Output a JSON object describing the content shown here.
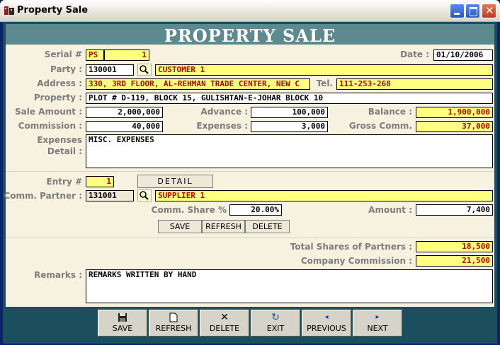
{
  "window": {
    "title": "Property Sale"
  },
  "header": {
    "title": "PROPERTY SALE"
  },
  "labels": {
    "serial": "Serial #",
    "date": "Date :",
    "party": "Party :",
    "address": "Address :",
    "tel": "Tel.",
    "property": "Property :",
    "sale_amount": "Sale Amount :",
    "advance": "Advance :",
    "balance": "Balance :",
    "commission": "Commission :",
    "expenses": "Expenses :",
    "gross_comm": "Gross Comm.",
    "expenses_detail_1": "Expenses",
    "expenses_detail_2": "Detail :",
    "entry": "Entry #",
    "comm_partner": "Comm. Partner :",
    "comm_share": "Comm. Share %",
    "amount": "Amount :",
    "total_shares": "Total Shares of Partners :",
    "company_commission": "Company Commission :",
    "remarks": "Remarks :"
  },
  "fields": {
    "serial_prefix": "PS",
    "serial_no": "1",
    "date": "01/10/2006",
    "party_code": "130001",
    "party_name": "CUSTOMER 1",
    "address": "330, 3RD FLOOR, AL-REHMAN TRADE CENTER, NEW C",
    "tel": "111-253-268",
    "property": "PLOT # D-119, BLOCK 15, GULISHTAN-E-JOHAR BLOCK 10",
    "sale_amount": "2,000,000",
    "advance": "100,000",
    "balance": "1,900,000",
    "commission": "40,000",
    "expenses": "3,000",
    "gross_comm": "37,000",
    "expenses_detail": "MISC. EXPENSES",
    "entry": "1",
    "partner_code": "131001",
    "partner_name": "SUPPLIER 1",
    "comm_share": "20.00%",
    "amount": "7,400",
    "total_shares": "18,500",
    "company_commission": "21,500",
    "remarks": "REMARKS WRITTEN BY HAND"
  },
  "buttons": {
    "detail": "DETAIL",
    "partner_save": "SAVE",
    "partner_refresh": "REFRESH",
    "partner_delete": "DELETE"
  },
  "toolbar": [
    {
      "name": "save",
      "label": "SAVE",
      "icon": "floppy-icon"
    },
    {
      "name": "refresh",
      "label": "REFRESH",
      "icon": "page-icon"
    },
    {
      "name": "delete",
      "label": "DELETE",
      "icon": "x-icon"
    },
    {
      "name": "exit",
      "label": "EXIT",
      "icon": "exit-icon"
    },
    {
      "name": "previous",
      "label": "PREVIOUS",
      "icon": "left-arrow-icon"
    },
    {
      "name": "next",
      "label": "NEXT",
      "icon": "right-arrow-icon"
    }
  ],
  "colors": {
    "header_bg": "#5d8a8f",
    "field_yellow": "#ffff80",
    "field_red_text": "#c00000",
    "client_bg": "#f7f2e0"
  }
}
